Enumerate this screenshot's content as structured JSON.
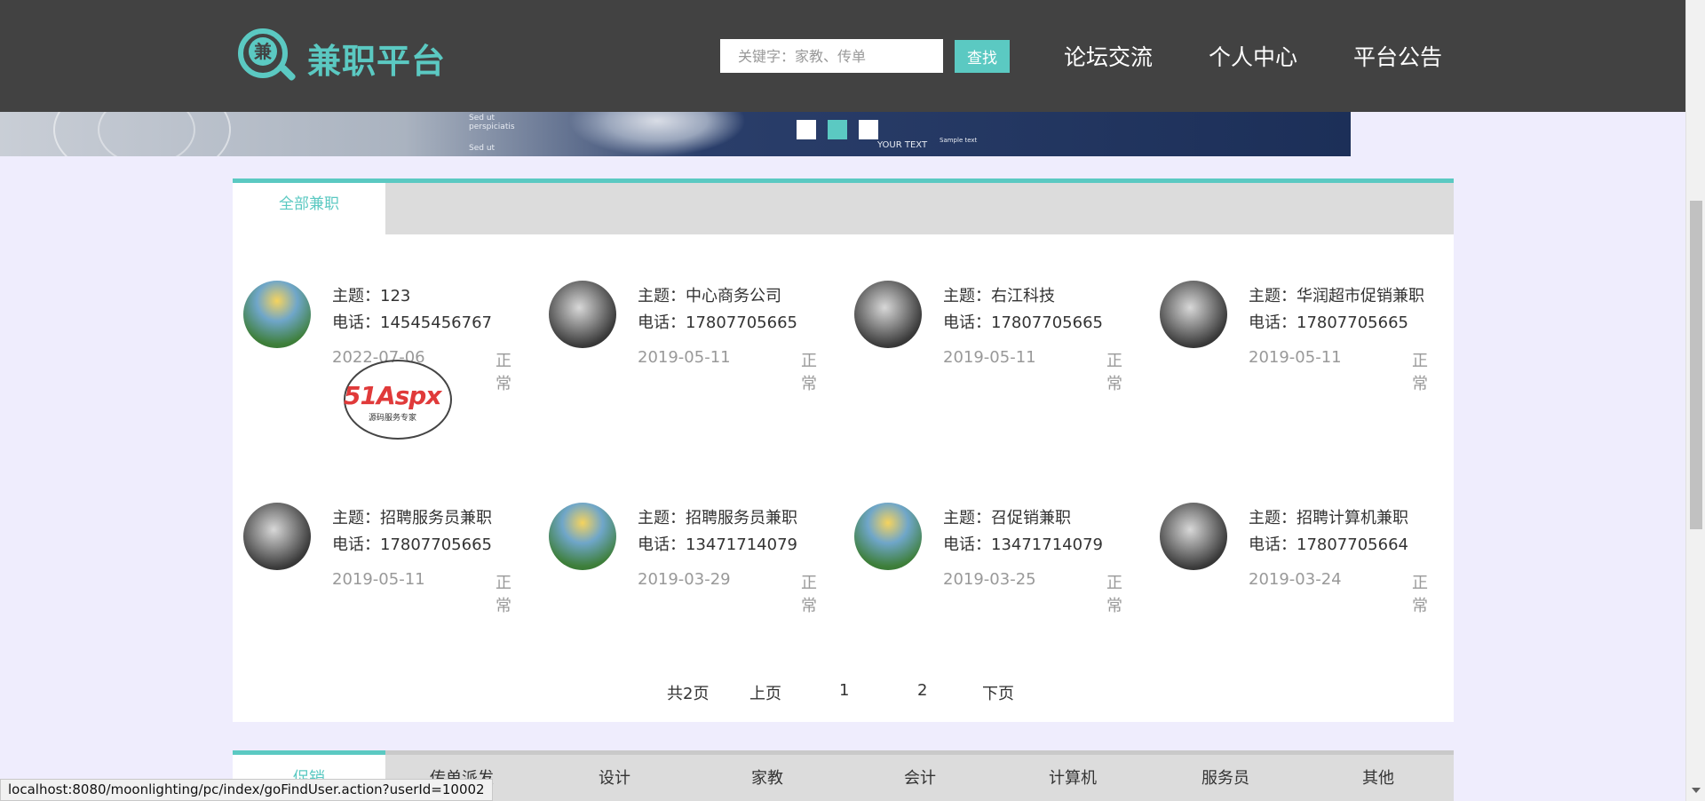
{
  "header": {
    "logo_char": "兼",
    "title": "兼职平台",
    "search_placeholder": "关键字：家教、传单",
    "search_button": "查找",
    "nav": {
      "forum": "论坛交流",
      "user_center": "个人中心",
      "notice": "平台公告"
    }
  },
  "banner": {
    "notes": [
      "Sed ut",
      "perspiciatis",
      "Sed ut",
      "YOUR TEXT",
      "Sample text"
    ],
    "active_dot": 2
  },
  "main": {
    "tab_all": "全部兼职",
    "jobs": [
      {
        "subject": "主题：123",
        "phone": "电话：14545456767",
        "date": "2022-07-06",
        "status": "正常",
        "avatar": "kids"
      },
      {
        "subject": "主题：中心商务公司",
        "phone": "电话：17807705665",
        "date": "2019-05-11",
        "status": "正常",
        "avatar": "knight"
      },
      {
        "subject": "主题：右江科技",
        "phone": "电话：17807705665",
        "date": "2019-05-11",
        "status": "正常",
        "avatar": "knight"
      },
      {
        "subject": "主题：华润超市促销兼职",
        "phone": "电话：17807705665",
        "date": "2019-05-11",
        "status": "正常",
        "avatar": "knight"
      },
      {
        "subject": "主题：招聘服务员兼职",
        "phone": "电话：17807705665",
        "date": "2019-05-11",
        "status": "正常",
        "avatar": "knight"
      },
      {
        "subject": "主题：招聘服务员兼职",
        "phone": "电话：13471714079",
        "date": "2019-03-29",
        "status": "正常",
        "avatar": "kids"
      },
      {
        "subject": "主题：召促销兼职",
        "phone": "电话：13471714079",
        "date": "2019-03-25",
        "status": "正常",
        "avatar": "kids"
      },
      {
        "subject": "主题：招聘计算机兼职",
        "phone": "电话：17807705664",
        "date": "2019-03-24",
        "status": "正常",
        "avatar": "knight"
      }
    ],
    "watermark": {
      "text": "51Aspx",
      "sub": "源码服务专家"
    },
    "pager": {
      "total": "共2页",
      "prev": "上页",
      "page1": "1",
      "page2": "2",
      "next": "下页"
    }
  },
  "categories": [
    "促销",
    "传单派发",
    "设计",
    "家教",
    "会计",
    "计算机",
    "服务员",
    "其他"
  ],
  "statusbar": {
    "url": "localhost:8080/moonlighting/pc/index/goFindUser.action?userId=10002"
  }
}
